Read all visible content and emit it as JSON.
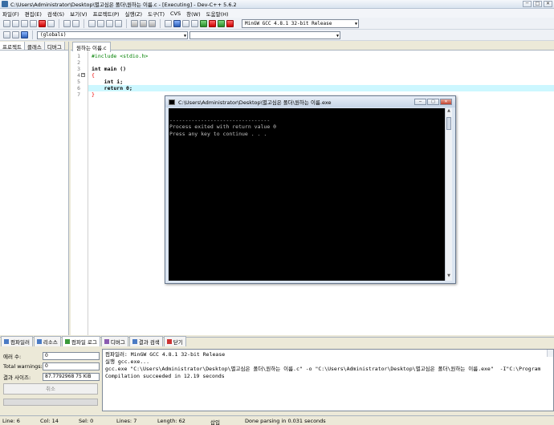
{
  "window": {
    "title": "C:\\Users\\Administrator\\Desktop\\별고심은 폴더\\원하는 이름.c - [Executing] - Dev-C++ 5.6.2"
  },
  "menu": [
    "파일(F)",
    "편집(E)",
    "검색(S)",
    "보기(V)",
    "프로젝트(P)",
    "실행(Z)",
    "도구(T)",
    "CVS",
    "창(W)",
    "도움말(H)"
  ],
  "toolbar": {
    "compiler": "MinGW GCC 4.8.1 32-bit Release",
    "scope": "(globals)",
    "symbol": ""
  },
  "left_panel": {
    "tabs": [
      "프로젝트",
      "클래스",
      "디버그"
    ]
  },
  "editor": {
    "tab": "원하는 이름.c",
    "lines": [
      {
        "num": "1",
        "text": "#include <stdio.h>"
      },
      {
        "num": "2",
        "text": ""
      },
      {
        "num": "3",
        "text": "int main ()"
      },
      {
        "num": "4",
        "text": "{"
      },
      {
        "num": "5",
        "text": "    int i;"
      },
      {
        "num": "6",
        "text": "    return 0;"
      },
      {
        "num": "7",
        "text": "}"
      }
    ],
    "current_line": 6
  },
  "console": {
    "title": "C:\\Users\\Administrator\\Desktop\\별고심은 폴더\\원하는 이름.exe",
    "lines": [
      "",
      "--------------------------------",
      "Process exited with return value 0",
      "Press any key to continue . . ."
    ],
    "buttons": {
      "minimize": "─",
      "maximize": "□",
      "close": "✕"
    }
  },
  "bottom_tabs": [
    "컴파일러",
    "리소스",
    "컴파일 로그",
    "디버그",
    "결과 검색",
    "닫기"
  ],
  "bottom_tab_active": 2,
  "stats": {
    "errors_label": "에러 수:",
    "errors": "0",
    "warnings_label": "Total warnings:",
    "warnings": "0",
    "size_label": "결과 사이즈:",
    "size": "87.7792968 75 KiB",
    "abort": "취소"
  },
  "log": [
    "컴파일러: MinGW GCC 4.8.1 32-bit Release",
    "실행 gcc.exe...",
    "gcc.exe \"C:\\Users\\Administrator\\Desktop\\별고심은 폴더\\원하는 이름.c\" -o \"C:\\Users\\Administrator\\Desktop\\별고심은 폴더\\원하는 이름.exe\"  -I\"C:\\Program",
    "Compilation succeeded in 12.19 seconds"
  ],
  "status": {
    "line": "Line:   6",
    "col": "Col:   14",
    "sel": "Sel:   0",
    "lines": "Lines:   7",
    "length": "Length:   62",
    "mode": "삽입",
    "message": "Done parsing in 0.031 seconds"
  },
  "colors": {
    "current_line": "#ccf7ff",
    "include": "#008000",
    "brace": "#ee0000",
    "number": "#800080"
  }
}
